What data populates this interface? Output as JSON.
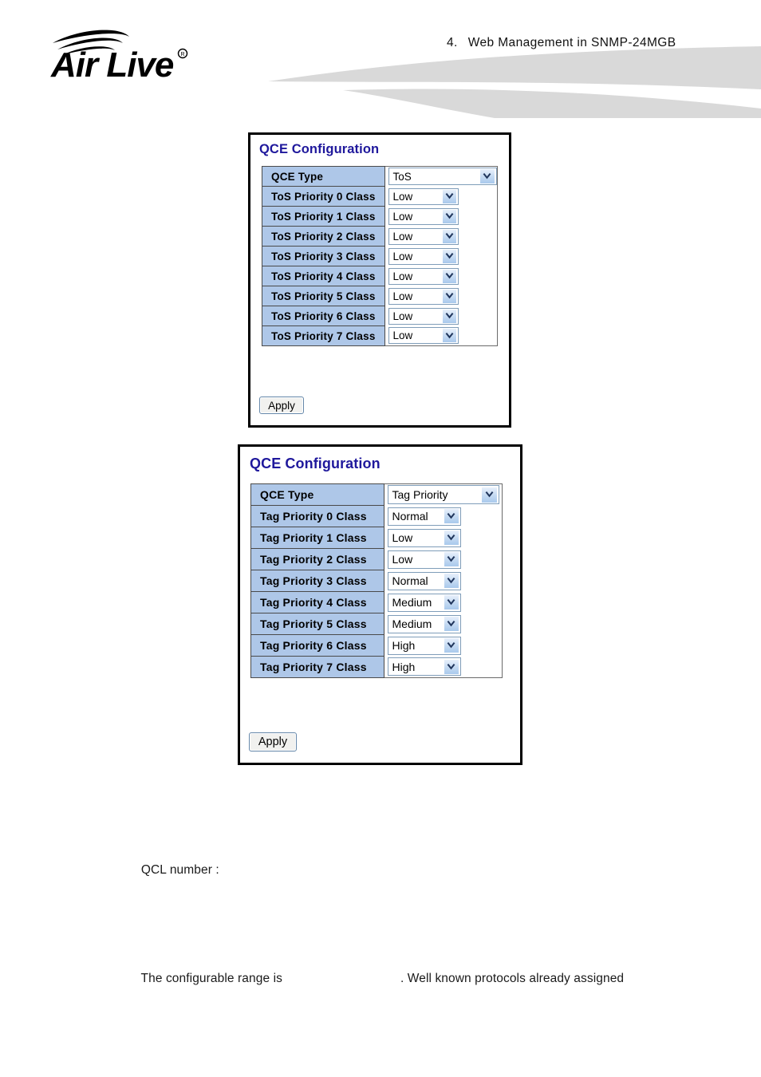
{
  "header": {
    "logo_text": "Air Live",
    "logo_name": "airlive-logo",
    "chapter_number": "4.",
    "chapter_title": "Web  Management  in  SNMP-24MGB"
  },
  "panels": [
    {
      "title": "QCE Configuration",
      "apply_label": "Apply",
      "rows": [
        {
          "label": "QCE Type",
          "value": "ToS",
          "select_size": "wide"
        },
        {
          "label": "ToS Priority 0 Class",
          "value": "Low",
          "select_size": "narrow"
        },
        {
          "label": "ToS Priority 1 Class",
          "value": "Low",
          "select_size": "narrow"
        },
        {
          "label": "ToS Priority 2 Class",
          "value": "Low",
          "select_size": "narrow"
        },
        {
          "label": "ToS Priority 3 Class",
          "value": "Low",
          "select_size": "narrow"
        },
        {
          "label": "ToS Priority 4 Class",
          "value": "Low",
          "select_size": "narrow"
        },
        {
          "label": "ToS Priority 5 Class",
          "value": "Low",
          "select_size": "narrow"
        },
        {
          "label": "ToS Priority 6 Class",
          "value": "Low",
          "select_size": "narrow"
        },
        {
          "label": "ToS Priority 7 Class",
          "value": "Low",
          "select_size": "narrow"
        }
      ]
    },
    {
      "title": "QCE Configuration",
      "apply_label": "Apply",
      "rows": [
        {
          "label": "QCE Type",
          "value": "Tag Priority",
          "select_size": "wide"
        },
        {
          "label": "Tag Priority 0 Class",
          "value": "Normal",
          "select_size": "narrow"
        },
        {
          "label": "Tag Priority 1 Class",
          "value": "Low",
          "select_size": "narrow"
        },
        {
          "label": "Tag Priority 2 Class",
          "value": "Low",
          "select_size": "narrow"
        },
        {
          "label": "Tag Priority 3 Class",
          "value": "Normal",
          "select_size": "narrow"
        },
        {
          "label": "Tag Priority 4 Class",
          "value": "Medium",
          "select_size": "narrow"
        },
        {
          "label": "Tag Priority 5 Class",
          "value": "Medium",
          "select_size": "narrow"
        },
        {
          "label": "Tag Priority 6 Class",
          "value": "High",
          "select_size": "narrow"
        },
        {
          "label": "Tag Priority 7 Class",
          "value": "High",
          "select_size": "narrow"
        }
      ]
    }
  ],
  "body": {
    "paragraph_1": "QCL number :",
    "paragraph_2_part_a": "The configurable range is",
    "paragraph_2_part_b": ". Well known protocols already assigned"
  },
  "colors": {
    "panel_title": "#1f189c",
    "label_cell_bg": "#aec7e8",
    "panel_border": "#000000",
    "swoosh": "#d7d7d7"
  }
}
